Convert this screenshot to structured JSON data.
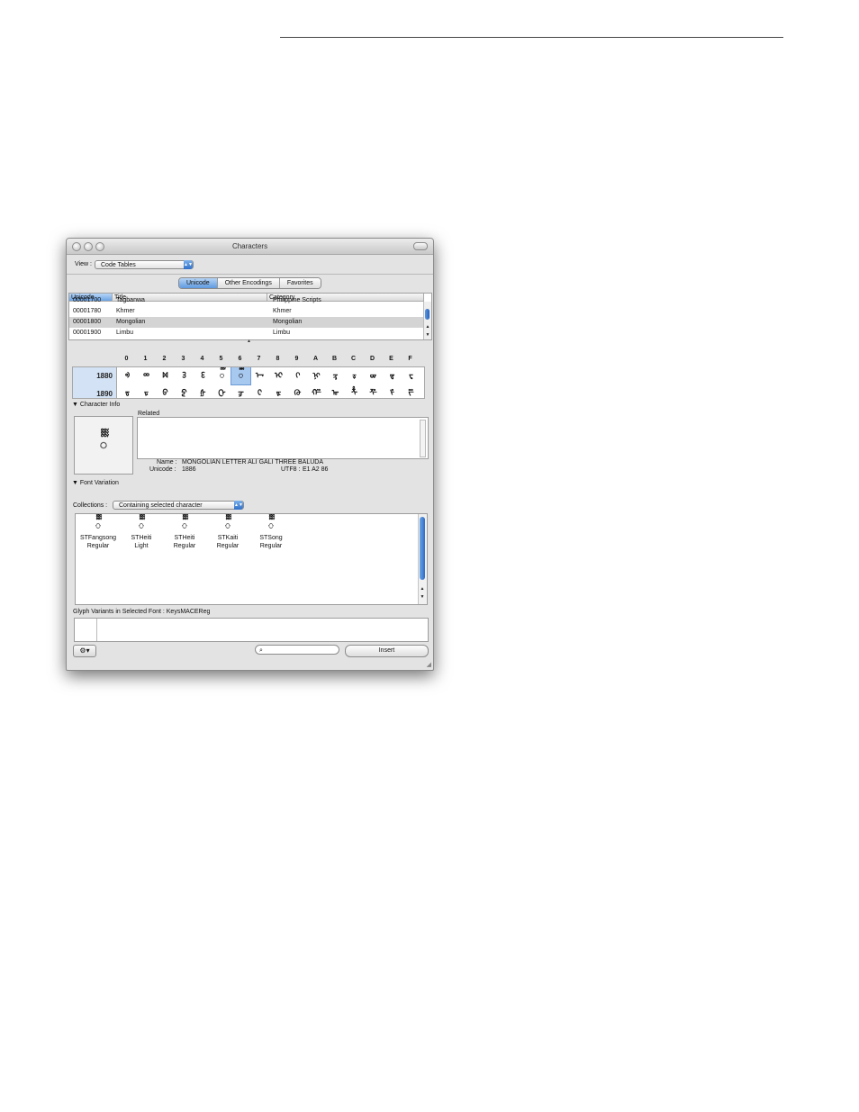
{
  "window": {
    "title": "Characters"
  },
  "view": {
    "label": "View :",
    "value": "Code Tables"
  },
  "tabs": [
    {
      "label": "Unicode",
      "selected": true
    },
    {
      "label": "Other Encodings",
      "selected": false
    },
    {
      "label": "Favorites",
      "selected": false
    }
  ],
  "table": {
    "columns": [
      "Unicode",
      "Title",
      "Category"
    ],
    "rows": [
      {
        "code": "00001700",
        "title": "Tagbanwa",
        "category": "Philippine Scripts"
      },
      {
        "code": "00001780",
        "title": "Khmer",
        "category": "Khmer"
      },
      {
        "code": "00001800",
        "title": "Mongolian",
        "category": "Mongolian",
        "selected": true
      },
      {
        "code": "00001900",
        "title": "Limbu",
        "category": "Limbu"
      }
    ]
  },
  "grid": {
    "col_headers": [
      "0",
      "1",
      "2",
      "3",
      "4",
      "5",
      "6",
      "7",
      "8",
      "9",
      "A",
      "B",
      "C",
      "D",
      "E",
      "F"
    ],
    "rows": [
      {
        "label": "1880",
        "glyphs": [
          "ᢀ",
          "ᢁ",
          "ᢂ",
          "ᢃ",
          "ᢄ",
          "ᢅ",
          "ᢆ",
          "ᢇ",
          "ᢈ",
          "ᢉ",
          "ᢊ",
          "ᢋ",
          "ᢌ",
          "ᢍ",
          "ᢎ",
          "ᢏ"
        ]
      },
      {
        "label": "1890",
        "glyphs": [
          "ᢐ",
          "ᢑ",
          "ᢒ",
          "ᢓ",
          "ᢔ",
          "ᢕ",
          "ᢖ",
          "ᢗ",
          "ᢘ",
          "ᢙ",
          "ᢚ",
          "ᢛ",
          "ᢜ",
          "ᢝ",
          "ᢞ",
          "ᢟ"
        ]
      }
    ],
    "selected_col": 6
  },
  "character_info": {
    "header": "Character Info",
    "preview_glyph": "ᢆ",
    "related_label": "Related",
    "name_label": "Name :",
    "name_value": "MONGOLIAN LETTER ALI GALI THREE BALUDA",
    "unicode_label": "Unicode :",
    "unicode_value": "1886",
    "utf8_label": "UTF8 :",
    "utf8_value": "E1 A2 86"
  },
  "font_variation": {
    "header": "Font Variation",
    "collections_label": "Collections :",
    "collections_value": "Containing selected character",
    "fonts": [
      {
        "glyph": "ᢆ",
        "name": "STFangsong",
        "style": "Regular"
      },
      {
        "glyph": "ᢆ",
        "name": "STHeiti",
        "style": "Light"
      },
      {
        "glyph": "ᢆ",
        "name": "STHeiti",
        "style": "Regular"
      },
      {
        "glyph": "ᢆ",
        "name": "STKaiti",
        "style": "Regular"
      },
      {
        "glyph": "ᢆ",
        "name": "STSong",
        "style": "Regular"
      }
    ]
  },
  "glyph_variants": {
    "label": "Glyph Variants in Selected Font : KeysMACEReg"
  },
  "bottom": {
    "gear_label": "⚙▾",
    "search_placeholder": "",
    "insert_label": "Insert"
  },
  "colors": {
    "selection_blue": "#6aa3e3",
    "scroll_blue": "#2e6bc4"
  }
}
